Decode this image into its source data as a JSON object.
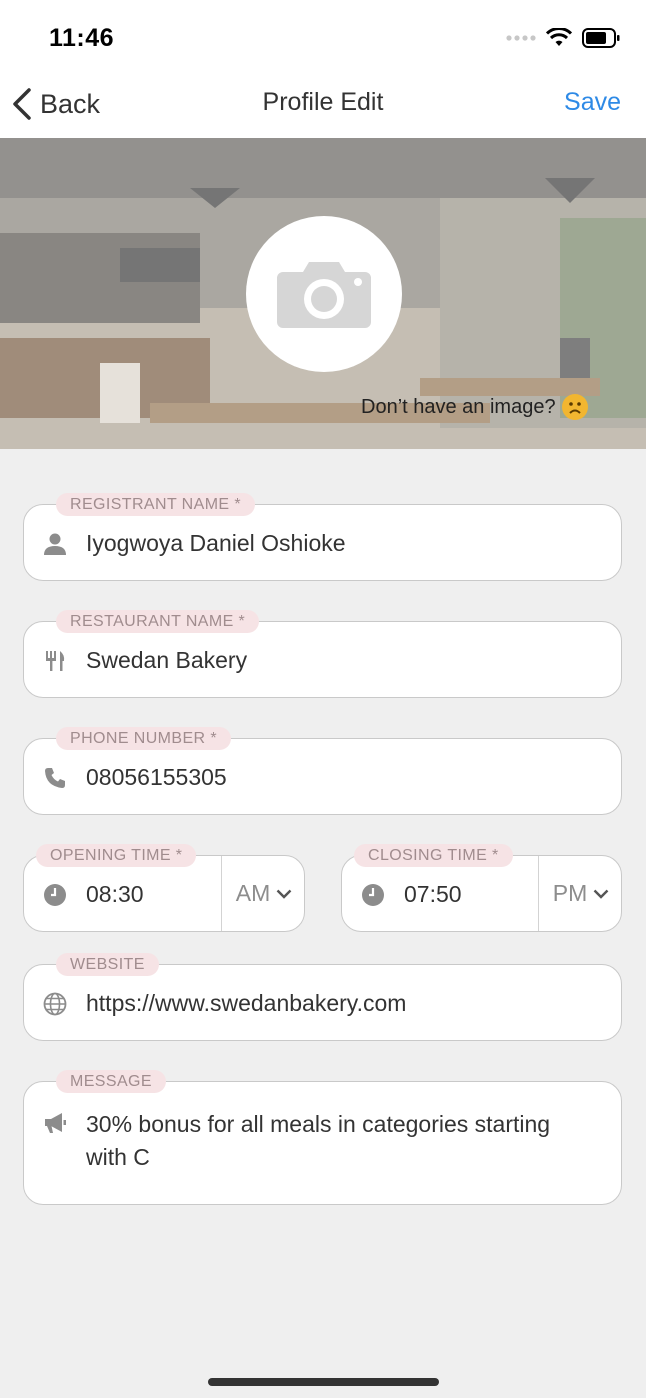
{
  "status": {
    "time": "11:46"
  },
  "nav": {
    "back_label": "Back",
    "title": "Profile Edit",
    "save_label": "Save"
  },
  "hero": {
    "no_image_text": "Don’t have an image?"
  },
  "fields": {
    "registrant": {
      "label": "REGISTRANT NAME *",
      "value": "Iyogwoya Daniel Oshioke",
      "icon": "person-icon"
    },
    "restaurant": {
      "label": "RESTAURANT NAME *",
      "value": "Swedan Bakery",
      "icon": "fork-knife-icon"
    },
    "phone": {
      "label": "PHONE NUMBER *",
      "value": "08056155305",
      "icon": "phone-icon"
    },
    "opening": {
      "label": "OPENING TIME *",
      "value": "08:30",
      "period": "AM",
      "icon": "clock-icon"
    },
    "closing": {
      "label": "CLOSING TIME *",
      "value": "07:50",
      "period": "PM",
      "icon": "clock-icon"
    },
    "website": {
      "label": "WEBSITE",
      "value": "https://www.swedanbakery.com",
      "icon": "globe-icon"
    },
    "message": {
      "label": "MESSAGE",
      "line1": "30% bonus for all meals in categories starting",
      "line2": "with C",
      "icon": "megaphone-icon"
    }
  },
  "colors": {
    "accent": "#2e8ae6",
    "label_bg": "#f6e3e5",
    "label_text": "#a08c8e",
    "page_bg": "#efefef"
  }
}
